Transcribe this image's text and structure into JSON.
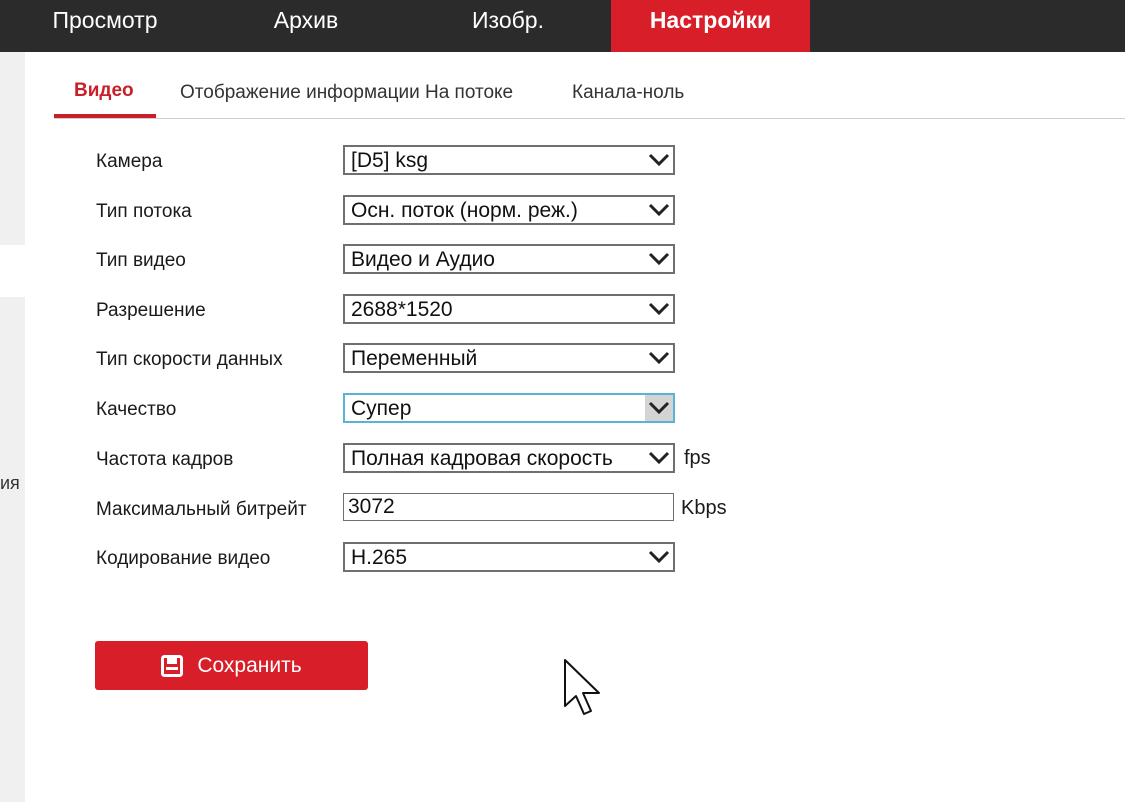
{
  "nav": {
    "items": [
      "Просмотр",
      "Архив",
      "Изобр.",
      "Настройки"
    ],
    "active_index": 3
  },
  "sidebar": {
    "fragment": "ия"
  },
  "tabs": {
    "items": [
      "Видео",
      "Отображение информации На потоке",
      "Канала-ноль"
    ],
    "active_index": 0
  },
  "form": {
    "camera": {
      "label": "Камера",
      "value": "[D5] ksg"
    },
    "stream_type": {
      "label": "Тип потока",
      "value": "Осн. поток (норм. реж.)"
    },
    "video_type": {
      "label": "Тип видео",
      "value": "Видео и Аудио"
    },
    "resolution": {
      "label": "Разрешение",
      "value": "2688*1520"
    },
    "bitrate_type": {
      "label": "Тип скорости данных",
      "value": "Переменный"
    },
    "quality": {
      "label": "Качество",
      "value": "Супер"
    },
    "frame_rate": {
      "label": "Частота кадров",
      "value": "Полная кадровая скорость",
      "unit": "fps"
    },
    "max_bitrate": {
      "label": "Максимальный битрейт",
      "value": "3072",
      "unit": "Kbps"
    },
    "video_encoding": {
      "label": "Кодирование видео",
      "value": "H.265"
    }
  },
  "save_button": {
    "label": "Сохранить"
  },
  "colors": {
    "accent": "#d81e28",
    "nav_bg": "#2b2b2b",
    "focus_border": "#59b3d6"
  },
  "icons": {
    "select_arrow": "chevron-down-icon",
    "save": "floppy-disk-icon",
    "cursor": "mouse-pointer-icon"
  }
}
